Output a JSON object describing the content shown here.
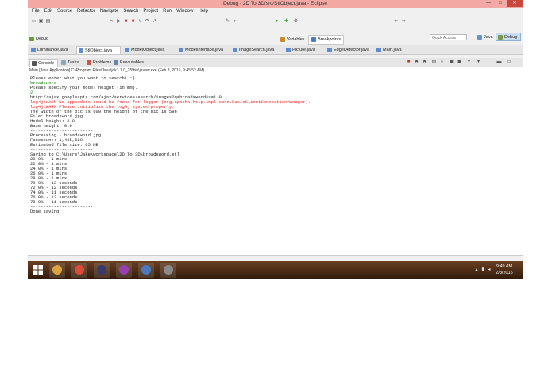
{
  "window": {
    "title": "Debug - 2D To 3D/src/StlObject.java - Eclipse",
    "min_label": "—",
    "max_label": "□",
    "close_label": "✕"
  },
  "menu": [
    "File",
    "Edit",
    "Source",
    "Refactor",
    "Navigate",
    "Search",
    "Project",
    "Run",
    "Window",
    "Help"
  ],
  "toolbar": {
    "quick_access_placeholder": "Quick Access",
    "perspective_java": "Java",
    "perspective_debug": "Debug"
  },
  "views": {
    "debug_tab": "Debug",
    "variables_tab": "Variables",
    "breakpoints_tab": "Breakpoints"
  },
  "editor_tabs": [
    "Luminance.java",
    "StlObject.java",
    "ModelObject.java",
    "ModelInterface.java",
    "ImageSearch.java",
    "Picture.java",
    "EdgeDetector.java",
    "Main.java"
  ],
  "console_tabs": [
    "Console",
    "Tasks",
    "Problems",
    "Executables"
  ],
  "console_header": "Main [Java Application] C:\\Program Files\\Java\\jdk1.7.0_25\\bin\\javaw.exe (Feb 8, 2015, 9:45:52 AM)",
  "console_lines": [
    {
      "text": "Please enter what you want to search! :)",
      "color": "black"
    },
    {
      "text": "broadsword",
      "color": "green"
    },
    {
      "text": "Please specify your model height (in mm).",
      "color": "black"
    },
    {
      "text": "2",
      "color": "green"
    },
    {
      "text": "http://ajax.googleapis.com/ajax/services/search/images?q=broadsword&v=1.0",
      "color": "black"
    },
    {
      "text": "log4j:WARN No appenders could be found for logger (org.apache.http.impl.conn.BasicClientConnectionManager).",
      "color": "red"
    },
    {
      "text": "log4j:WARN Please initialize the log4j system properly.",
      "color": "red"
    },
    {
      "text": "The width of the pic is 600 the height of the pic is 596",
      "color": "black"
    },
    {
      "text": "File: broadsword.jpg",
      "color": "black"
    },
    {
      "text": "Model height: 2.0",
      "color": "black"
    },
    {
      "text": "Base height: 0.0",
      "color": "black"
    },
    {
      "text": "------------------------",
      "color": "black"
    },
    {
      "text": "Processing - broadsword.jpg",
      "color": "black"
    },
    {
      "text": "Facecount: 1,425,620",
      "color": "black"
    },
    {
      "text": "Estimated file size: 65 MB",
      "color": "black"
    },
    {
      "text": "------------------------",
      "color": "black"
    },
    {
      "text": "Saving to C:\\Users\\Jake\\workspace\\2D To 3D\\broadsword.stl",
      "color": "black"
    },
    {
      "text": "20.0% - 1 mins",
      "color": "black"
    },
    {
      "text": "22.0% - 1 mins",
      "color": "black"
    },
    {
      "text": "24.0% - 1 mins",
      "color": "black"
    },
    {
      "text": "26.0% - 1 mins",
      "color": "black"
    },
    {
      "text": "28.0% - 1 mins",
      "color": "black"
    },
    {
      "text": "70.0% - 13 seconds",
      "color": "black"
    },
    {
      "text": "72.0% - 12 seconds",
      "color": "black"
    },
    {
      "text": "74.0% - 11 seconds",
      "color": "black"
    },
    {
      "text": "76.0% - 13 seconds",
      "color": "black"
    },
    {
      "text": "78.0% - 11 seconds",
      "color": "black"
    },
    {
      "text": "------------------------",
      "color": "black"
    },
    {
      "text": "Done saving",
      "color": "black"
    }
  ],
  "taskbar": {
    "apps": [
      "file-explorer",
      "chrome",
      "app-dark",
      "stl-viewer",
      "java",
      "settings"
    ],
    "app_colors": [
      "#d9a441",
      "#dd4b39",
      "#3a3a6a",
      "#9a3fb0",
      "#4a78c2",
      "#8a8a8a"
    ],
    "time": "9:49 AM",
    "date": "2/8/2015"
  }
}
